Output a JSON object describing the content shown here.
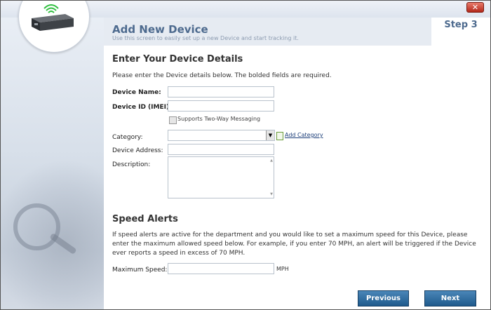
{
  "window": {
    "close_label": "✕"
  },
  "header": {
    "title": "Add New Device",
    "subtitle": "Use this screen to easily set up a new Device and start tracking it.",
    "step": "Step 3"
  },
  "details": {
    "heading": "Enter Your Device Details",
    "intro": "Please enter the Device details below. The bolded fields are required.",
    "device_name_label": "Device Name:",
    "device_name_value": "",
    "device_id_label": "Device ID (IMEI):",
    "device_id_value": "",
    "two_way_label": "Supports Two-Way Messaging",
    "two_way_checked": false,
    "category_label": "Category:",
    "category_value": "",
    "add_category_label": "Add Category",
    "address_label": "Device Address:",
    "address_value": "",
    "description_label": "Description:",
    "description_value": ""
  },
  "speed": {
    "heading": "Speed Alerts",
    "intro": "If speed alerts are active for the department and you would like to set a maximum speed for this Device, please enter the maximum allowed speed below. For example, if you enter 70 MPH, an alert will be triggered if the Device ever reports a speed in excess of 70 MPH.",
    "max_label": "Maximum Speed:",
    "max_value": "",
    "unit": "MPH"
  },
  "buttons": {
    "previous": "Previous",
    "next": "Next"
  },
  "icons": {
    "close": "close-icon",
    "device": "device-icon",
    "dropdown": "chevron-down-icon",
    "add_category": "add-icon",
    "scroll_up": "scroll-up-icon",
    "scroll_down": "scroll-down-icon"
  },
  "colors": {
    "title": "#4d6a8e",
    "button": "#2a6a9e",
    "link": "#1d3f7a"
  }
}
